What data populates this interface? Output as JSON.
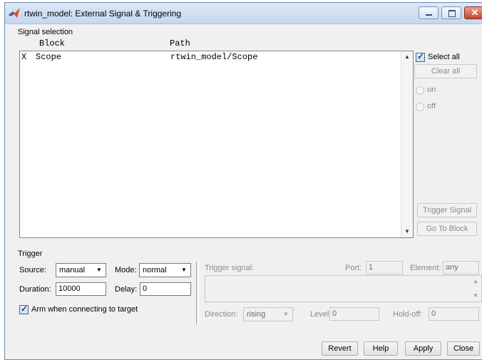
{
  "window": {
    "title": "rtwin_model: External Signal & Triggering"
  },
  "signal_selection": {
    "group_label": "Signal selection",
    "columns": {
      "block": "Block",
      "path": "Path"
    },
    "rows": [
      {
        "mark": "X",
        "block": "Scope",
        "path": "rtwin_model/Scope"
      }
    ],
    "select_all": {
      "label": "Select all",
      "checked": true
    },
    "clear_all_label": "Clear all",
    "on_label": "on",
    "off_label": "off",
    "trigger_signal_label": "Trigger Signal",
    "go_to_block_label": "Go To Block"
  },
  "trigger": {
    "group_label": "Trigger",
    "source_label": "Source:",
    "source_value": "manual",
    "mode_label": "Mode:",
    "mode_value": "normal",
    "duration_label": "Duration:",
    "duration_value": "10000",
    "delay_label": "Delay:",
    "delay_value": "0",
    "arm_label": "Arm when connecting to target",
    "arm_checked": true,
    "trigger_signal_label": "Trigger signal:",
    "port_label": "Port:",
    "port_value": "1",
    "element_label": "Element:",
    "element_value": "any",
    "direction_label": "Direction:",
    "direction_value": "rising",
    "level_label": "Level:",
    "level_value": "0",
    "holdoff_label": "Hold-off:",
    "holdoff_value": "0"
  },
  "footer": {
    "revert": "Revert",
    "help": "Help",
    "apply": "Apply",
    "close": "Close"
  },
  "icons": {
    "close_glyph": "✕"
  }
}
